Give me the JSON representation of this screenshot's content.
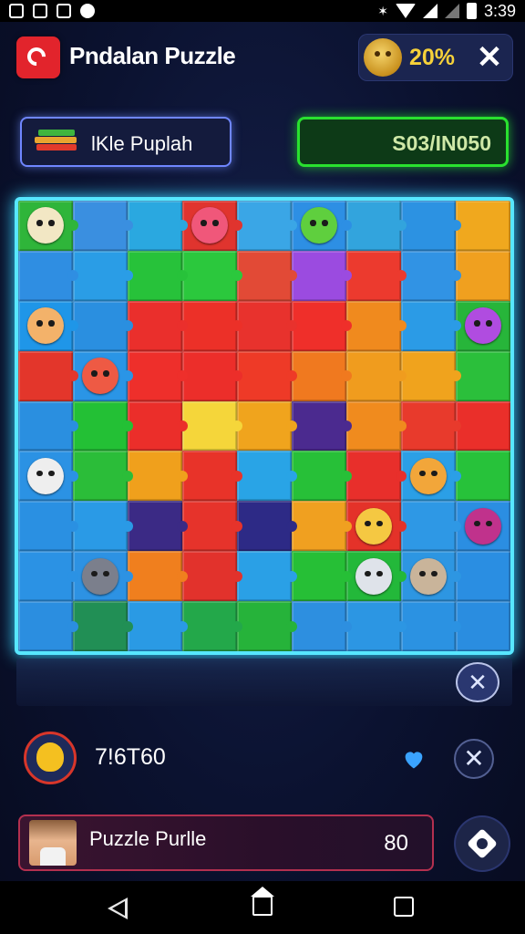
{
  "status_bar": {
    "time": "3:39"
  },
  "header": {
    "app_title": "Pndalan Puzzle",
    "progress_label": "20%",
    "close_symbol": "✕"
  },
  "level_button": {
    "label": "lKle Puplah"
  },
  "target": {
    "label": "S03/IN050"
  },
  "board": {
    "columns": 9,
    "rows": 9,
    "tile_colors": [
      [
        "#2fb53a",
        "#3a8fe0",
        "#2aa8e0",
        "#e0342e",
        "#3aa6e6",
        "#2d8fe4",
        "#32a4dd",
        "#2c92e2",
        "#f0a81e"
      ],
      [
        "#2f8ee2",
        "#2a9de6",
        "#27c23a",
        "#2bc83d",
        "#e24a36",
        "#9b4be0",
        "#ec3a2e",
        "#3193e4",
        "#f0a01f"
      ],
      [
        "#1f96e8",
        "#2a8fe0",
        "#ea2f2c",
        "#ec3028",
        "#e8322d",
        "#ef2f2a",
        "#f08a1e",
        "#2b9be6",
        "#27b53a"
      ],
      [
        "#e3362b",
        "#2a95e6",
        "#ee2f2b",
        "#ec2e2a",
        "#ee3a27",
        "#f0791f",
        "#f09c1e",
        "#f0a31d",
        "#2bbf3b"
      ],
      [
        "#2a8fe0",
        "#23c035",
        "#eb2e2a",
        "#f5d63a",
        "#f0a41d",
        "#4b2a8f",
        "#f08b1e",
        "#e83a2c",
        "#ea2f2a"
      ],
      [
        "#2b92e4",
        "#2bbd39",
        "#f0a01c",
        "#e83329",
        "#29a4e6",
        "#27c038",
        "#e82f2b",
        "#2b9fe6",
        "#27c23a"
      ],
      [
        "#2a90e2",
        "#2a9ae6",
        "#3b2a85",
        "#e6332b",
        "#2d2a86",
        "#f0a020",
        "#e43229",
        "#2e98e5",
        "#2b8ee2"
      ],
      [
        "#2b92e4",
        "#2d92e3",
        "#f07f1e",
        "#e2322c",
        "#2aa0e6",
        "#26bf36",
        "#23b83a",
        "#2d96e2",
        "#2a8ee2"
      ],
      [
        "#2b8ee0",
        "#218f55",
        "#2a9ae4",
        "#23a84a",
        "#26b33a",
        "#2d8fe0",
        "#2c96e3",
        "#2b92e2",
        "#2a8de0"
      ]
    ],
    "characters": [
      {
        "name": "character-bird",
        "color": "#f2e7c4",
        "col": 0,
        "row": 0
      },
      {
        "name": "character-pink-troll",
        "color": "#f0577a",
        "col": 3,
        "row": 0
      },
      {
        "name": "character-green-blob",
        "color": "#5fcf3e",
        "col": 5,
        "row": 0
      },
      {
        "name": "character-purple-fish",
        "color": "#b04ce0",
        "col": 8,
        "row": 2
      },
      {
        "name": "character-redhead-girl",
        "color": "#f3b26a",
        "col": 0,
        "row": 2
      },
      {
        "name": "character-red-monster",
        "color": "#ee5a44",
        "col": 1,
        "row": 3
      },
      {
        "name": "character-white-cat",
        "color": "#eeeeee",
        "col": 0,
        "row": 5
      },
      {
        "name": "character-orange-fox",
        "color": "#f2a63a",
        "col": 7,
        "row": 5
      },
      {
        "name": "character-yellow-skull",
        "color": "#f5c842",
        "col": 6,
        "row": 6
      },
      {
        "name": "character-purple-demon",
        "color": "#c0328c",
        "col": 8,
        "row": 6
      },
      {
        "name": "character-gray-ghost",
        "color": "#7b7f8c",
        "col": 1,
        "row": 7
      },
      {
        "name": "character-white-shark",
        "color": "#dfe3ea",
        "col": 6,
        "row": 7
      },
      {
        "name": "character-tan-bird",
        "color": "#c9b49a",
        "col": 7,
        "row": 7
      }
    ]
  },
  "reflection": {
    "close_symbol": "✕"
  },
  "player": {
    "score": "7!6T60",
    "close_symbol": "✕"
  },
  "card": {
    "name": "Puzzle Purlle",
    "value": "80"
  }
}
